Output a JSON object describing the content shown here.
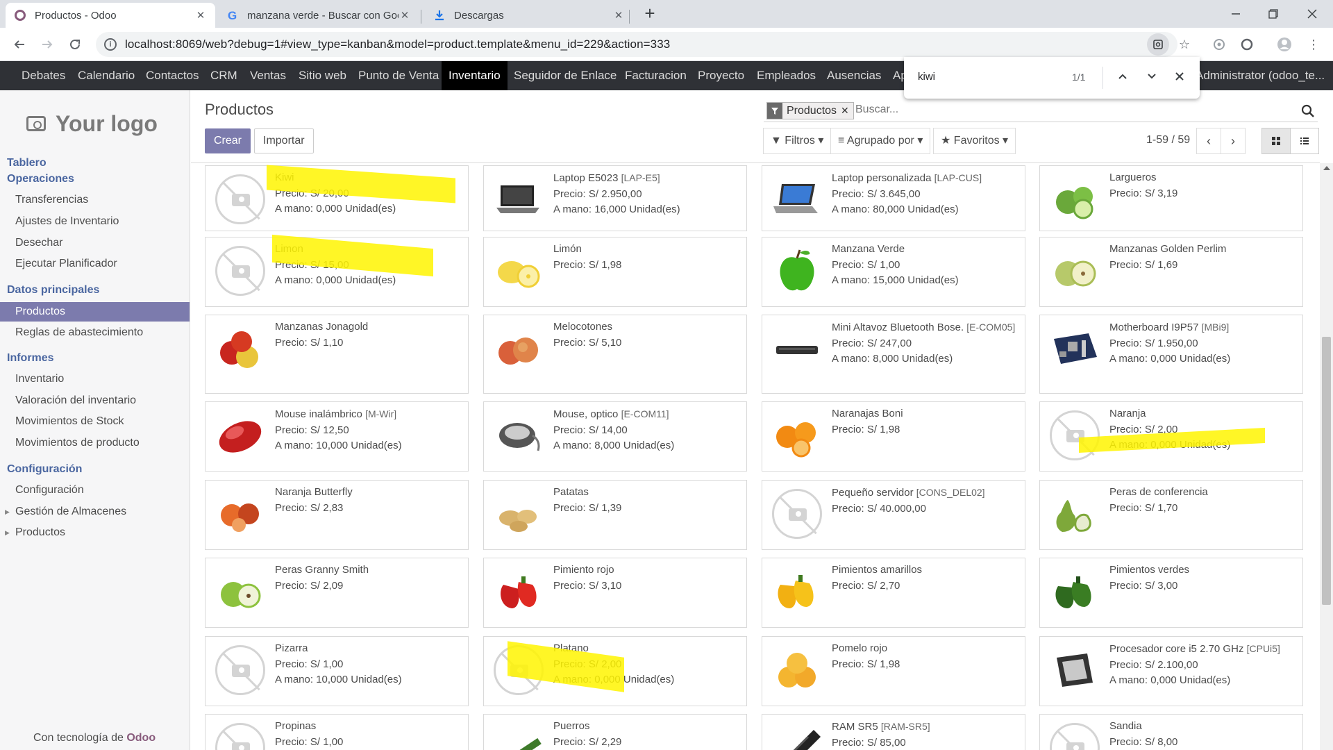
{
  "browser": {
    "tabs": [
      {
        "title": "Productos - Odoo",
        "icon": "odoo-icon"
      },
      {
        "title": "manzana verde - Buscar con Goo",
        "icon": "google-icon"
      },
      {
        "title": "Descargas",
        "icon": "download-icon"
      }
    ],
    "url": "localhost:8069/web?debug=1#view_type=kanban&model=product.template&menu_id=229&action=333"
  },
  "find_bar": {
    "query": "kiwi",
    "count": "1/1"
  },
  "top_menu": {
    "items": [
      "Debates",
      "Calendario",
      "Contactos",
      "CRM",
      "Ventas",
      "Sitio web",
      "Punto de Venta",
      "Inventario",
      "Seguidor de Enlace",
      "Facturacion",
      "Proyecto",
      "Empleados",
      "Ausencias",
      "Ap"
    ],
    "active": "Inventario",
    "user": "Administrator (odoo_te..."
  },
  "sidebar": {
    "logo_text": "Your logo",
    "sections": [
      {
        "title": "Tablero"
      },
      {
        "title": "Operaciones",
        "items": [
          "Transferencias",
          "Ajustes de Inventario",
          "Desechar",
          "Ejecutar Planificador"
        ]
      },
      {
        "title": "Datos principales",
        "items": [
          "Productos",
          "Reglas de abastecimiento"
        ]
      },
      {
        "title": "Informes",
        "items": [
          "Inventario",
          "Valoración del inventario",
          "Movimientos de Stock",
          "Movimientos de producto"
        ]
      },
      {
        "title": "Configuración",
        "items": [
          "Configuración",
          "Gestión de Almacenes",
          "Productos"
        ]
      }
    ],
    "powered_prefix": "Con tecnología de ",
    "powered_brand": "Odoo"
  },
  "control_panel": {
    "title": "Productos",
    "create_label": "Crear",
    "import_label": "Importar",
    "facet_label": "Productos",
    "search_placeholder": "Buscar...",
    "filters_label": "Filtros",
    "groupby_label": "Agrupado por",
    "favorites_label": "Favoritos",
    "pager": "1-59 / 59"
  },
  "products": [
    {
      "name": "Kiwi",
      "ref": "",
      "price": "Precio: S/ 20,00",
      "onhand": "A mano: 0,000 Unidad(es)",
      "image": "placeholder",
      "highlight": "kiwi"
    },
    {
      "name": "Laptop E5023",
      "ref": "[LAP-E5]",
      "price": "Precio: S/ 2.950,00",
      "onhand": "A mano: 16,000 Unidad(es)",
      "image": "laptop"
    },
    {
      "name": "Laptop personalizada",
      "ref": "[LAP-CUS]",
      "price": "Precio: S/ 3.645,00",
      "onhand": "A mano: 80,000 Unidad(es)",
      "image": "laptop-blue"
    },
    {
      "name": "Largueros",
      "ref": "",
      "price": "Precio: S/ 3,19",
      "onhand": "",
      "image": "limes"
    },
    {
      "name": "Limon",
      "ref": "",
      "price": "Precio: S/ 15,00",
      "onhand": "A mano: 0,000 Unidad(es)",
      "image": "placeholder",
      "highlight": "limon"
    },
    {
      "name": "Limón",
      "ref": "",
      "price": "Precio: S/ 1,98",
      "onhand": "",
      "image": "lemons"
    },
    {
      "name": "Manzana Verde",
      "ref": "",
      "price": "Precio: S/ 1,00",
      "onhand": "A mano: 15,000 Unidad(es)",
      "image": "green-apple"
    },
    {
      "name": "Manzanas Golden Perlim",
      "ref": "",
      "price": "Precio: S/ 1,69",
      "onhand": "",
      "image": "golden-apples"
    },
    {
      "name": "Manzanas Jonagold",
      "ref": "",
      "price": "Precio: S/ 1,10",
      "onhand": "",
      "image": "red-apples"
    },
    {
      "name": "Melocotones",
      "ref": "",
      "price": "Precio: S/ 5,10",
      "onhand": "",
      "image": "peaches"
    },
    {
      "name": "Mini Altavoz Bluetooth Bose.",
      "ref": "[E-COM05]",
      "price": "Precio: S/ 247,00",
      "onhand": "A mano: 8,000 Unidad(es)",
      "image": "speaker"
    },
    {
      "name": "Motherboard I9P57",
      "ref": "[MBi9]",
      "price": "Precio: S/ 1.950,00",
      "onhand": "A mano: 0,000 Unidad(es)",
      "image": "motherboard"
    },
    {
      "name": "Mouse inalámbrico",
      "ref": "[M-Wir]",
      "price": "Precio: S/ 12,50",
      "onhand": "A mano: 10,000 Unidad(es)",
      "image": "mouse-red"
    },
    {
      "name": "Mouse, optico",
      "ref": "[E-COM11]",
      "price": "Precio: S/ 14,00",
      "onhand": "A mano: 8,000 Unidad(es)",
      "image": "mouse-grey"
    },
    {
      "name": "Naranajas Boni",
      "ref": "",
      "price": "Precio: S/ 1,98",
      "onhand": "",
      "image": "oranges"
    },
    {
      "name": "Naranja",
      "ref": "",
      "price": "Precio: S/ 2,00",
      "onhand": "A mano: 0,000 Unidad(es)",
      "image": "placeholder",
      "highlight": "naranja"
    },
    {
      "name": "Naranja Butterfly",
      "ref": "",
      "price": "Precio: S/ 2,83",
      "onhand": "",
      "image": "blood-oranges"
    },
    {
      "name": "Patatas",
      "ref": "",
      "price": "Precio: S/ 1,39",
      "onhand": "",
      "image": "potatoes"
    },
    {
      "name": "Pequeño servidor",
      "ref": "[CONS_DEL02]",
      "price": "Precio: S/ 40.000,00",
      "onhand": "",
      "image": "placeholder"
    },
    {
      "name": "Peras de conferencia",
      "ref": "",
      "price": "Precio: S/ 1,70",
      "onhand": "",
      "image": "pears"
    },
    {
      "name": "Peras Granny Smith",
      "ref": "",
      "price": "Precio: S/ 2,09",
      "onhand": "",
      "image": "granny-apples"
    },
    {
      "name": "Pimiento rojo",
      "ref": "",
      "price": "Precio: S/ 3,10",
      "onhand": "",
      "image": "red-peppers"
    },
    {
      "name": "Pimientos amarillos",
      "ref": "",
      "price": "Precio: S/ 2,70",
      "onhand": "",
      "image": "yellow-peppers"
    },
    {
      "name": "Pimientos verdes",
      "ref": "",
      "price": "Precio: S/ 3,00",
      "onhand": "",
      "image": "green-peppers"
    },
    {
      "name": "Pizarra",
      "ref": "",
      "price": "Precio: S/ 1,00",
      "onhand": "A mano: 10,000 Unidad(es)",
      "image": "placeholder"
    },
    {
      "name": "Platano",
      "ref": "",
      "price": "Precio: S/ 2,00",
      "onhand": "A mano: 0,000 Unidad(es)",
      "image": "placeholder",
      "highlight": "platano"
    },
    {
      "name": "Pomelo rojo",
      "ref": "",
      "price": "Precio: S/ 1,98",
      "onhand": "",
      "image": "grapefruit"
    },
    {
      "name": "Procesador core i5 2.70 GHz",
      "ref": "[CPUi5]",
      "price": "Precio: S/ 2.100,00",
      "onhand": "A mano: 0,000 Unidad(es)",
      "image": "cpu"
    },
    {
      "name": "Propinas",
      "ref": "",
      "price": "Precio: S/ 1,00",
      "onhand": "",
      "image": "placeholder"
    },
    {
      "name": "Puerros",
      "ref": "",
      "price": "Precio: S/ 2,29",
      "onhand": "",
      "image": "leeks"
    },
    {
      "name": "RAM SR5",
      "ref": "[RAM-SR5]",
      "price": "Precio: S/ 85,00",
      "onhand": "",
      "image": "ram"
    },
    {
      "name": "Sandia",
      "ref": "",
      "price": "Precio: S/ 8,00",
      "onhand": "",
      "image": "placeholder"
    }
  ],
  "colors": {
    "odoo_purple": "#7c7bad",
    "menu_bg": "#2f3136",
    "highlight": "#fff500",
    "link_blue": "#4a66a0"
  }
}
